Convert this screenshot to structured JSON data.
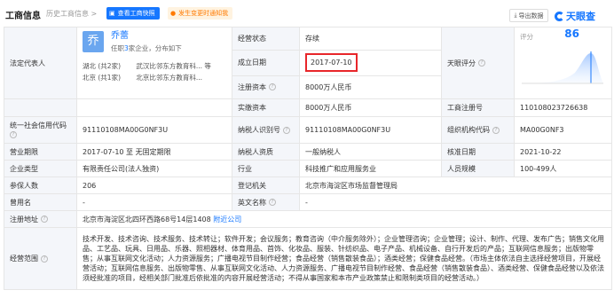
{
  "header": {
    "title": "工商信息",
    "history": "历史工商信息 >",
    "view_snapshot": "查看工商快照",
    "change_alert": "发生变更时通知我",
    "export": "导出数据",
    "logo": "天眼查"
  },
  "legal_rep": {
    "label": "法定代表人",
    "avatar_char": "乔",
    "name": "乔蕾",
    "sub_prefix": "任职",
    "sub_count": "3",
    "sub_suffix": "家企业，分布如下",
    "rows": [
      {
        "city": "湖北 (共2家)",
        "company": "武汉比邻东方教育科... 等"
      },
      {
        "city": "北京 (共1家)",
        "company": "北京比邻东方教育科..."
      }
    ]
  },
  "fields": {
    "status_label": "经营状态",
    "status_value": "存续",
    "est_date_label": "成立日期",
    "est_date_value": "2017-07-10",
    "reg_capital_label": "注册资本",
    "reg_capital_value": "8000万人民币",
    "paid_capital_label": "实缴资本",
    "paid_capital_value": "8000万人民币",
    "tianyan_score_label": "天眼评分",
    "reg_no_label": "工商注册号",
    "reg_no_value": "110108023726638",
    "credit_code_label": "统一社会信用代码",
    "credit_code_value": "91110108MA00G0NF3U",
    "taxpayer_id_label": "纳税人识别号",
    "taxpayer_id_value": "91110108MA00G0NF3U",
    "org_code_label": "组织机构代码",
    "org_code_value": "MA00G0NF3",
    "term_label": "营业期限",
    "term_value": "2017-07-10 至 无固定期限",
    "taxpayer_qual_label": "纳税人资质",
    "taxpayer_qual_value": "一般纳税人",
    "approve_date_label": "核准日期",
    "approve_date_value": "2021-10-22",
    "type_label": "企业类型",
    "type_value": "有限责任公司(法人独资)",
    "industry_label": "行业",
    "industry_value": "科技推广和应用服务业",
    "staff_label": "人员规模",
    "staff_value": "100-499人",
    "insured_label": "参保人数",
    "insured_value": "206",
    "authority_label": "登记机关",
    "authority_value": "北京市海淀区市场监督管理局",
    "former_name_label": "曾用名",
    "former_name_value": "-",
    "english_name_label": "英文名称",
    "english_name_value": "-",
    "address_label": "注册地址",
    "address_value": "北京市海淀区北四环西路68号14层1408",
    "address_link": "附近公司",
    "scope_label": "经营范围",
    "scope_value": "技术开发、技术咨询、技术服务、技术转让；软件开发；会议服务；教育咨询（中介服务除外）；企业管理咨询；企业管理；设计、制作、代理、发布广告；销售文化用品、工艺品、玩具、日用品、乐器、照相器材、体育用品、首饰、化妆品、服装、针纺织品、电子产品、机械设备、自行开发后的产品；互联网信息服务；出版物零售；从事互联网文化活动；人力资源服务；广播电视节目制作经营；食品经营（销售散装食品）；酒类经营；保健食品经营。（市场主体依法自主选择经营项目，开展经营活动；互联网信息服务、出版物零售、从事互联网文化活动、人力资源服务、广播电视节目制作经营、食品经营（销售散装食品）、酒类经营、保健食品经营以及依法须经批准的项目，经相关部门批准后依批准的内容开展经营活动；不得从事国家和本市产业政策禁止和限制类项目的经营活动。）"
  },
  "score": {
    "label": "评分",
    "value": "86",
    "axis": [
      "0",
      "10",
      "20",
      "30",
      "40",
      "50",
      "60",
      "70",
      "80",
      "90",
      "100"
    ]
  },
  "colors": {
    "accent": "#1677ff",
    "highlight": "#e8262a",
    "label_bg": "#f4f6fa"
  }
}
